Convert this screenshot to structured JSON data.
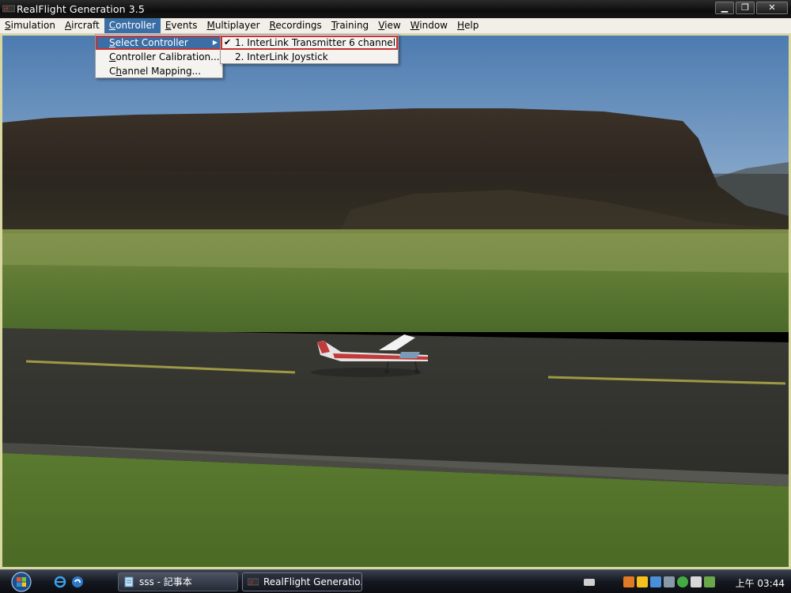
{
  "window": {
    "title": "RealFlight Generation 3.5",
    "controls": {
      "minimize": "▁",
      "restore": "❐",
      "close": "✕"
    }
  },
  "menubar": {
    "items": [
      {
        "label": "Simulation",
        "accel": "S",
        "rest": "imulation"
      },
      {
        "label": "Aircraft",
        "accel": "A",
        "rest": "ircraft"
      },
      {
        "label": "Controller",
        "accel": "C",
        "rest": "ontroller"
      },
      {
        "label": "Events",
        "accel": "E",
        "rest": "vents"
      },
      {
        "label": "Multiplayer",
        "accel": "M",
        "rest": "ultiplayer"
      },
      {
        "label": "Recordings",
        "accel": "R",
        "rest": "ecordings"
      },
      {
        "label": "Training",
        "accel": "T",
        "rest": "raining"
      },
      {
        "label": "View",
        "accel": "V",
        "rest": "iew"
      },
      {
        "label": "Window",
        "accel": "W",
        "rest": "indow"
      },
      {
        "label": "Help",
        "accel": "H",
        "rest": "elp"
      }
    ],
    "active_index": 2
  },
  "controller_menu": {
    "items": [
      {
        "label": "Select Controller",
        "accel": "S",
        "rest": "elect Controller"
      },
      {
        "label": "Controller Calibration...",
        "accel": "C",
        "rest": "ontroller Calibration..."
      },
      {
        "label": "Channel Mapping...",
        "accel": "h",
        "pre": "C",
        "rest": "annel Mapping..."
      }
    ]
  },
  "select_controller_submenu": {
    "items": [
      {
        "label": "1. InterLink Transmitter 6 channel",
        "checked": true
      },
      {
        "label": "2. InterLink Joystick",
        "checked": false
      }
    ]
  },
  "taskbar": {
    "tasks": [
      {
        "label": "sss - 記事本",
        "icon": "notepad-icon"
      },
      {
        "label": "RealFlight Generatio...",
        "icon": "realflight-icon"
      }
    ],
    "clock": "上午 03:44"
  },
  "colors": {
    "menu_highlight": "#3a6ea5",
    "selection_outline": "#c8312f",
    "menubar_bg": "#f1efe7"
  }
}
